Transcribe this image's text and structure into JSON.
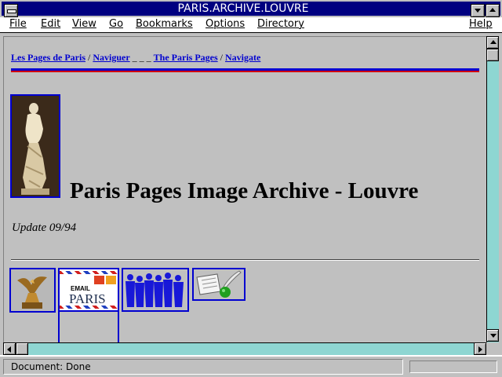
{
  "window": {
    "title": "PARIS.ARCHIVE.LOUVRE"
  },
  "menubar": {
    "items": [
      {
        "label": "File"
      },
      {
        "label": "Edit"
      },
      {
        "label": "View"
      },
      {
        "label": "Go"
      },
      {
        "label": "Bookmarks"
      },
      {
        "label": "Options"
      },
      {
        "label": "Directory"
      },
      {
        "label": "Help"
      }
    ]
  },
  "breadcrumb": {
    "link1": "Les Pages de Paris",
    "sep1": " / ",
    "link2": "Naviguer",
    "sep2": " _ _ _ ",
    "link3": "The Paris Pages",
    "sep3": " / ",
    "link4": "Navigate"
  },
  "page": {
    "title": "Paris Pages Image Archive - Louvre",
    "update": "Update 09/94"
  },
  "thumbnails": {
    "email_small": "EMAIL",
    "email_big": "PARIS",
    "icons": [
      "angel-statue-icon",
      "email-paris-icon",
      "crowd-silhouettes-icon",
      "quill-scroll-icon"
    ]
  },
  "status": {
    "text": "Document: Done"
  },
  "colors": {
    "titlebar": "#000080",
    "link": "#0000d0",
    "background": "#c0c0c0",
    "scroll_track": "#9ee5e0"
  }
}
